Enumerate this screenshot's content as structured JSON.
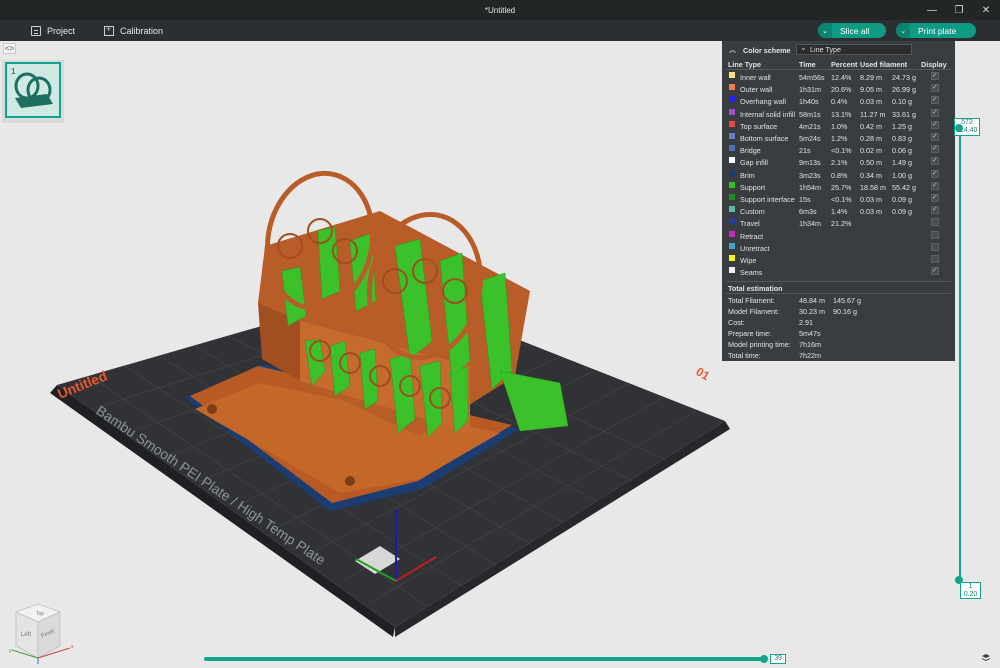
{
  "window": {
    "title": "*Untitled"
  },
  "menu": {
    "project": "Project",
    "calibration": "Calibration"
  },
  "actions": {
    "slice_all": "Slice all",
    "print_plate": "Print plate"
  },
  "plate": {
    "number": "1",
    "name": "Untitled",
    "plate_index": "01",
    "plate_label": "Bambu Smooth PEI Plate / High Temp Plate"
  },
  "color_scheme": {
    "label": "Color scheme",
    "value": "Line Type",
    "headers": {
      "line_type": "Line Type",
      "time": "Time",
      "percent": "Percent",
      "used_filament": "Used filament",
      "display": "Display"
    },
    "rows": [
      {
        "name": "Inner wall",
        "color": "#f6e27a",
        "time": "54m56s",
        "percent": "12.4%",
        "length": "8.29 m",
        "weight": "24.73 g",
        "display": true
      },
      {
        "name": "Outer wall",
        "color": "#f08040",
        "time": "1h31m",
        "percent": "20.6%",
        "length": "9.05 m",
        "weight": "26.99 g",
        "display": true
      },
      {
        "name": "Overhang wall",
        "color": "#2424ee",
        "time": "1h40s",
        "percent": "0.4%",
        "length": "0.03 m",
        "weight": "0.10 g",
        "display": true
      },
      {
        "name": "Internal solid infill",
        "color": "#a050d8",
        "time": "58m1s",
        "percent": "13.1%",
        "length": "11.27 m",
        "weight": "33.61 g",
        "display": true
      },
      {
        "name": "Top surface",
        "color": "#e84a48",
        "time": "4m21s",
        "percent": "1.0%",
        "length": "0.42 m",
        "weight": "1.25 g",
        "display": true
      },
      {
        "name": "Bottom surface",
        "color": "#6880c8",
        "time": "5m24s",
        "percent": "1.2%",
        "length": "0.28 m",
        "weight": "0.83 g",
        "display": true
      },
      {
        "name": "Bridge",
        "color": "#4c6fb0",
        "time": "21s",
        "percent": "<0.1%",
        "length": "0.02 m",
        "weight": "0.06 g",
        "display": true
      },
      {
        "name": "Gap infill",
        "color": "#ffffff",
        "time": "9m13s",
        "percent": "2.1%",
        "length": "0.50 m",
        "weight": "1.49 g",
        "display": true
      },
      {
        "name": "Brim",
        "color": "#1c3c70",
        "time": "3m23s",
        "percent": "0.8%",
        "length": "0.34 m",
        "weight": "1.00 g",
        "display": true
      },
      {
        "name": "Support",
        "color": "#34c024",
        "time": "1h54m",
        "percent": "25.7%",
        "length": "18.58 m",
        "weight": "55.42 g",
        "display": true
      },
      {
        "name": "Support interface",
        "color": "#1e8f18",
        "time": "15s",
        "percent": "<0.1%",
        "length": "0.03 m",
        "weight": "0.09 g",
        "display": true
      },
      {
        "name": "Custom",
        "color": "#58bca8",
        "time": "6m3s",
        "percent": "1.4%",
        "length": "0.03 m",
        "weight": "0.09 g",
        "display": true
      },
      {
        "name": "Travel",
        "color": "#2c3c9c",
        "time": "1h34m",
        "percent": "21.2%",
        "length": "",
        "weight": "",
        "display": false
      },
      {
        "name": "Retract",
        "color": "#c02cc0",
        "time": "",
        "percent": "",
        "length": "",
        "weight": "",
        "display": false
      },
      {
        "name": "Unretract",
        "color": "#40a4c8",
        "time": "",
        "percent": "",
        "length": "",
        "weight": "",
        "display": false
      },
      {
        "name": "Wipe",
        "color": "#f6f61c",
        "time": "",
        "percent": "",
        "length": "",
        "weight": "",
        "display": false
      },
      {
        "name": "Seams",
        "color": "#f0f0f0",
        "time": "",
        "percent": "",
        "length": "",
        "weight": "",
        "display": true
      }
    ]
  },
  "totals": {
    "title": "Total estimation",
    "rows": [
      {
        "label": "Total Filament:",
        "v1": "48.84 m",
        "v2": "145.67 g"
      },
      {
        "label": "Model Filament:",
        "v1": "30.23 m",
        "v2": "90.16 g"
      },
      {
        "label": "Cost:",
        "v1": "2.91",
        "v2": ""
      },
      {
        "label": "Prepare time:",
        "v1": "5m47s",
        "v2": ""
      },
      {
        "label": "Model printing time:",
        "v1": "7h16m",
        "v2": ""
      },
      {
        "label": "Total time:",
        "v1": "7h22m",
        "v2": ""
      }
    ]
  },
  "layer_slider": {
    "top_layer": "572",
    "top_height": "114.40",
    "bottom_layer": "1",
    "bottom_height": "0.20"
  },
  "move_slider": {
    "value": "39"
  },
  "nav_cube": {
    "top": "Top",
    "left": "Left",
    "front": "Front"
  },
  "icons": {
    "project": "project-icon",
    "calibration": "calibration-icon",
    "layers": "layers-icon"
  }
}
